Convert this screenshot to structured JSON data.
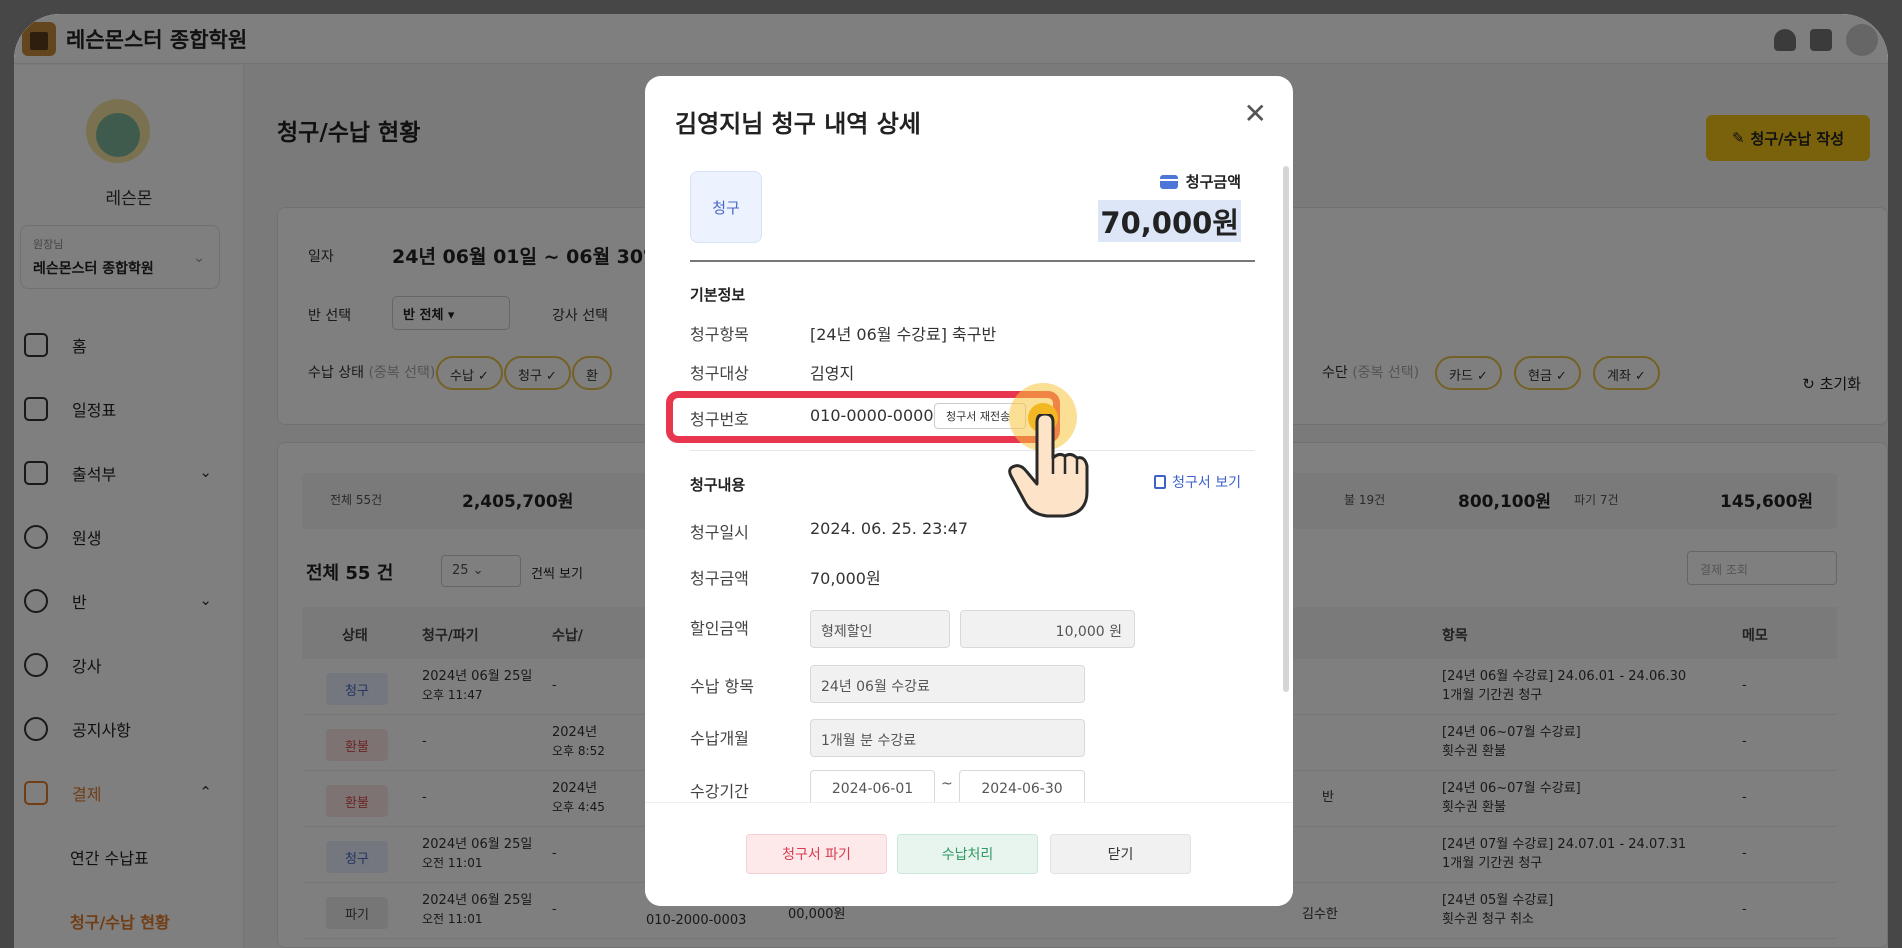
{
  "app": {
    "title": "레슨몬스터 종합학원"
  },
  "sidebar": {
    "profile_name": "레슨몬",
    "role_label": "원장님",
    "role_value": "레슨몬스터 종합학원",
    "items": [
      {
        "label": "홈",
        "icon": "home-icon"
      },
      {
        "label": "일정표",
        "icon": "calendar-icon"
      },
      {
        "label": "출석부",
        "icon": "book-icon"
      },
      {
        "label": "원생",
        "icon": "smile-icon"
      },
      {
        "label": "반",
        "icon": "class-icon"
      },
      {
        "label": "강사",
        "icon": "person-icon"
      },
      {
        "label": "공지사항",
        "icon": "chat-icon"
      },
      {
        "label": "결제",
        "icon": "card-icon"
      }
    ],
    "sub_items": [
      "연간 수납표",
      "청구/수납 현황"
    ]
  },
  "page": {
    "title": "청구/수납 현황",
    "create_button": "청구/수납 작성",
    "date_label": "일자",
    "date_value": "24년 06월 01일 ~ 06월 30일",
    "class_label": "반 선택",
    "class_value": "반 전체",
    "teacher_label": "강사 선택",
    "status_label": "수납 상태",
    "status_hint": "(중복 선택)",
    "status_chips": [
      "수납",
      "청구",
      "환"
    ],
    "method_label": "수단",
    "method_hint": "(중복 선택)",
    "method_chips": [
      "카드",
      "현금",
      "계좌"
    ],
    "reset": "초기화"
  },
  "stats": {
    "total_label": "전체 55건",
    "total_value": "2,405,700원",
    "unpaid_label": "불 19건",
    "unpaid_value": "800,100원",
    "void_label": "파기 7건",
    "void_value": "145,600원"
  },
  "table": {
    "total": "전체 55 건",
    "per_page": "25",
    "per_page_label": "건씩 보기",
    "search_placeholder": "결제 조회",
    "headers": [
      "상태",
      "청구/파기",
      "수납/",
      "항목",
      "메모"
    ],
    "rows": [
      {
        "status": "청구",
        "date": "2024년 06월 25일",
        "time": "오후 11:47",
        "paid": "-",
        "paid_time": "",
        "item1": "[24년 06월 수강료] 24.06.01 - 24.06.30",
        "item2": "1개월 기간권 청구",
        "memo": "-"
      },
      {
        "status": "환불",
        "date": "-",
        "time": "",
        "paid": "2024년",
        "paid_time": "오후 8:52",
        "item1": "[24년 06~07월 수강료]",
        "item2": "횟수권 환불",
        "memo": "-"
      },
      {
        "status": "환불",
        "date": "-",
        "time": "",
        "paid": "2024년",
        "paid_time": "오후 4:45",
        "item1": "[24년 06~07월 수강료]",
        "item2": "횟수권 환불",
        "memo": "-"
      },
      {
        "status": "청구",
        "date": "2024년 06월 25일",
        "time": "오전 11:01",
        "paid": "-",
        "paid_time": "",
        "item1": "[24년 07월 수강료] 24.07.01 - 24.07.31",
        "item2": "1개월 기간권 청구",
        "memo": "-"
      },
      {
        "status": "파기",
        "date": "2024년 06월 25일",
        "time": "오전 11:01",
        "paid": "-",
        "paid_time": "",
        "item1": "[24년 05월 수강료]",
        "item2": "횟수권 청구 취소",
        "memo": "-"
      }
    ],
    "partial_phone": "010-2000-0003",
    "partial_amount": "00,000원",
    "partial_teacher": "김수한",
    "partial_class": "반"
  },
  "modal": {
    "title": "김영지님 청구 내역 상세",
    "badge": "청구",
    "amount_label": "청구금액",
    "amount_value": "70,000원",
    "basic_title": "기본정보",
    "item_label": "청구항목",
    "item_value": "[24년 06월 수강료] 축구반",
    "target_label": "청구대상",
    "target_value": "김영지",
    "number_label": "청구번호",
    "number_value": "010-0000-0000",
    "resend_button": "청구서 재전송",
    "content_title": "청구내용",
    "view_invoice": "청구서 보기",
    "date_label": "청구일시",
    "date_value": "2024. 06. 25. 23:47",
    "charge_label": "청구금액",
    "charge_value": "70,000원",
    "discount_label": "할인금액",
    "discount_type": "형제할인",
    "discount_amount": "10,000  원",
    "pay_item_label": "수납 항목",
    "pay_item_value": "24년 06월 수강료",
    "months_label": "수납개월",
    "months_value": "1개월 분 수강료",
    "period_label": "수강기간",
    "period_start": "2024-06-01",
    "period_sep": "~",
    "period_end": "2024-06-30",
    "btn_void": "청구서 파기",
    "btn_pay": "수납처리",
    "btn_close": "닫기"
  },
  "colors": {
    "accent": "#f5c518",
    "highlight": "#e8364f",
    "primary_blue": "#4668c8"
  }
}
